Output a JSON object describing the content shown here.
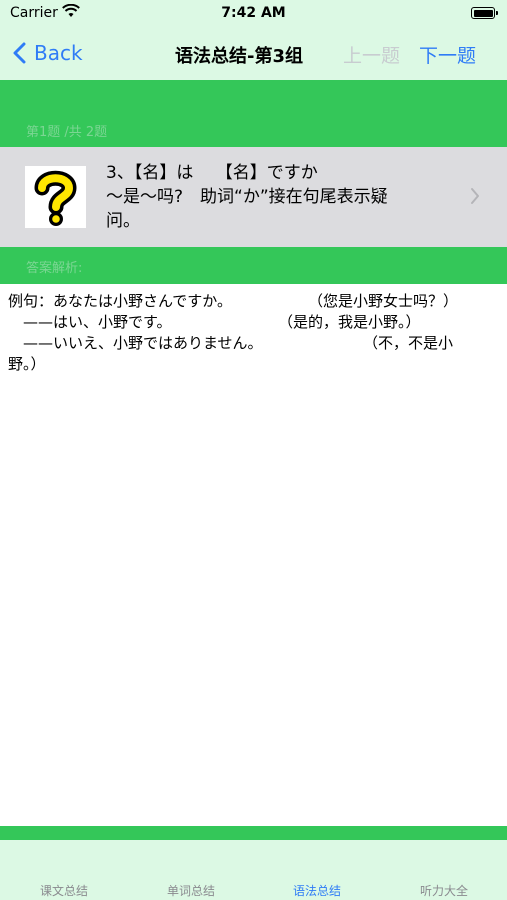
{
  "status_bar": {
    "carrier": "Carrier",
    "time": "7:42 AM"
  },
  "nav": {
    "back_label": "Back",
    "title": "语法总结-第3组",
    "prev_label": "上一题",
    "next_label": "下一题"
  },
  "progress": {
    "label": "第1题 /共 2题"
  },
  "question": {
    "thumbnail_icon": "question-mark-icon",
    "lines": [
      "3、【名】は　 【名】ですか",
      "～是～吗?　助词“か”接在句尾表示疑",
      "问。"
    ]
  },
  "answer": {
    "label": "答案解析:",
    "lines": [
      {
        "a": "例句：あなたは小野さんですか。",
        "b": "（您是小野女士吗？）"
      },
      {
        "a": "　——はい、小野です。",
        "b": "（是的，我是小野。）"
      },
      {
        "a": "　——いいえ、小野ではありません。",
        "b": "（不，不是小"
      },
      {
        "a": "野。）",
        "b": ""
      }
    ]
  },
  "tabs": [
    {
      "label": "课文总结",
      "active": false
    },
    {
      "label": "单词总结",
      "active": false
    },
    {
      "label": "语法总结",
      "active": true
    },
    {
      "label": "听力大全",
      "active": false
    }
  ],
  "colors": {
    "accent": "#2f7cf6",
    "green": "#34c759",
    "light_green": "#dcf9e4",
    "row_gray": "#dcdcdf"
  }
}
